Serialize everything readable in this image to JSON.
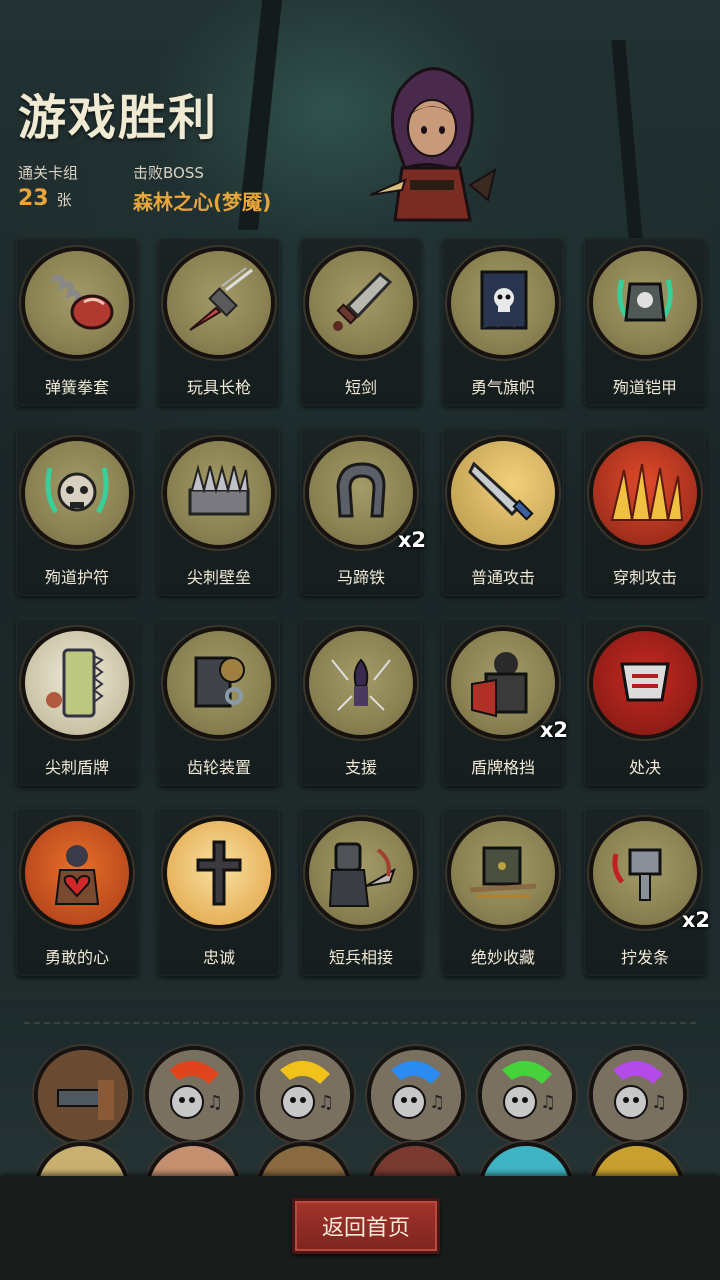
{
  "header": {
    "title": "游戏胜利",
    "deck_label": "通关卡组",
    "deck_count": "23",
    "deck_unit": "张",
    "boss_label": "击败BOSS",
    "boss_name": "森林之心(梦魇)"
  },
  "cards": [
    {
      "label": "弹簧拳套",
      "icon": "spring-glove-icon",
      "count": ""
    },
    {
      "label": "玩具长枪",
      "icon": "toy-lance-icon",
      "count": ""
    },
    {
      "label": "短剑",
      "icon": "short-sword-icon",
      "count": ""
    },
    {
      "label": "勇气旗帜",
      "icon": "skull-banner-icon",
      "count": ""
    },
    {
      "label": "殉道铠甲",
      "icon": "martyr-armor-icon",
      "count": ""
    },
    {
      "label": "殉道护符",
      "icon": "skull-amulet-icon",
      "count": ""
    },
    {
      "label": "尖刺壁垒",
      "icon": "spike-wall-icon",
      "count": ""
    },
    {
      "label": "马蹄铁",
      "icon": "horseshoe-icon",
      "count": "x2"
    },
    {
      "label": "普通攻击",
      "icon": "sword-strike-icon",
      "count": ""
    },
    {
      "label": "穿刺攻击",
      "icon": "pierce-attack-icon",
      "count": ""
    },
    {
      "label": "尖刺盾牌",
      "icon": "spiked-shield-icon",
      "count": ""
    },
    {
      "label": "齿轮装置",
      "icon": "gear-device-icon",
      "count": ""
    },
    {
      "label": "支援",
      "icon": "support-icon",
      "count": ""
    },
    {
      "label": "盾牌格挡",
      "icon": "shield-block-icon",
      "count": "x2"
    },
    {
      "label": "处决",
      "icon": "execute-icon",
      "count": ""
    },
    {
      "label": "勇敢的心",
      "icon": "brave-heart-icon",
      "count": ""
    },
    {
      "label": "忠诚",
      "icon": "loyalty-cross-icon",
      "count": ""
    },
    {
      "label": "短兵相接",
      "icon": "melee-knight-icon",
      "count": ""
    },
    {
      "label": "绝妙收藏",
      "icon": "treasure-chest-icon",
      "count": ""
    },
    {
      "label": "拧发条",
      "icon": "wind-up-key-icon",
      "count": "x2"
    }
  ],
  "relics_row1": [
    {
      "icon": "cannon-relic-icon",
      "color": "#6b4a32"
    },
    {
      "icon": "red-music-skull-icon",
      "color": "#e0441c"
    },
    {
      "icon": "yellow-music-skull-icon",
      "color": "#f0c21a"
    },
    {
      "icon": "blue-music-skull-icon",
      "color": "#2a8cf0"
    },
    {
      "icon": "green-music-skull-icon",
      "color": "#45d23a"
    },
    {
      "icon": "purple-music-skull-icon",
      "color": "#b44ae8"
    }
  ],
  "relics_row2": [
    {
      "icon": "lamp-relic-icon",
      "color": "#c9b070"
    },
    {
      "icon": "fist-relic-icon",
      "color": "#c49070"
    },
    {
      "icon": "frame-relic-icon",
      "color": "#8a6a40"
    },
    {
      "icon": "jester-relic-icon",
      "color": "#7a3a30"
    },
    {
      "icon": "cyan-relic-icon",
      "color": "#3fb4c4"
    },
    {
      "icon": "bottle-relic-icon",
      "color": "#c8a030"
    }
  ],
  "footer": {
    "home_button": "返回首页"
  }
}
